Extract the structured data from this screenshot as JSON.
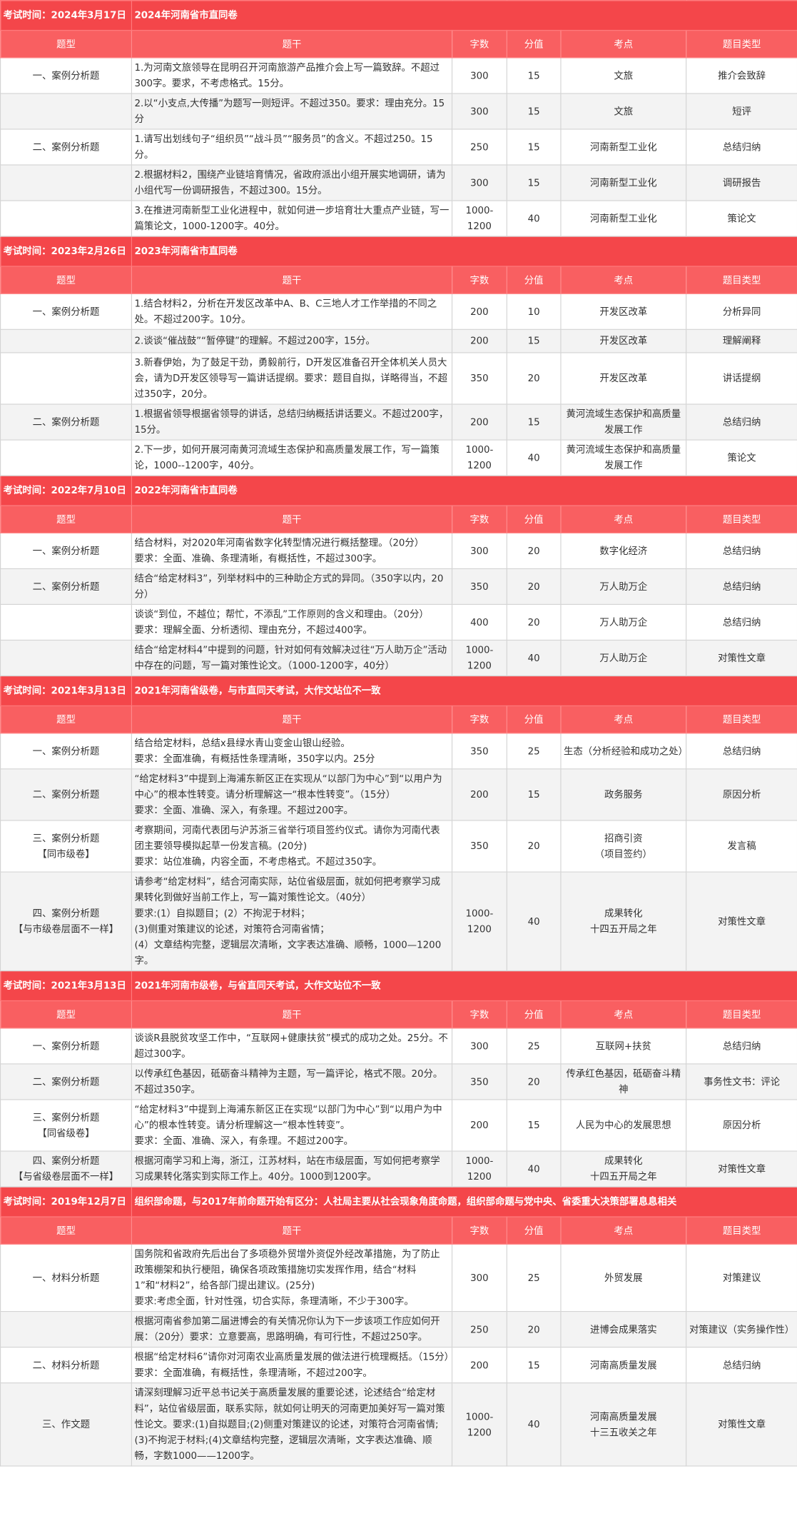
{
  "headers": [
    "题型",
    "题干",
    "字数",
    "分值",
    "考点",
    "题目类型"
  ],
  "sections": [
    {
      "time": "考试时间：2024年3月17日",
      "title": "2024年河南省市直同卷",
      "rows": [
        {
          "type": [
            "一、案例分析题"
          ],
          "stem": [
            "1.为河南文旅领导在昆明召开河南旅游产品推介会上写一篇致辞。不超过300字。要求，不考虑格式。15分。"
          ],
          "words": "300",
          "score": "15",
          "point": [
            "文旅"
          ],
          "qtype": "推介会致辞",
          "h": 39
        },
        {
          "type": [],
          "stem": [
            "2.以“小支点,大传播”为题写一则短评。不超过350。要求：理由充分。15分"
          ],
          "words": "300",
          "score": "15",
          "point": [
            "文旅"
          ],
          "qtype": "短评",
          "h": 28
        },
        {
          "type": [
            "二、案例分析题"
          ],
          "stem": [
            "1.请写出划线句子“组织员”“战斗员”“服务员”的含义。不超过250。15分。"
          ],
          "words": "250",
          "score": "15",
          "point": [
            "河南新型工业化"
          ],
          "qtype": "总结归纳",
          "h": 38
        },
        {
          "type": [],
          "stem": [
            "2.根据材料2，围绕产业链培育情况，省政府派出小组开展实地调研，请为小组代写一份调研报告，不超过300。15分。"
          ],
          "words": "300",
          "score": "15",
          "point": [
            "河南新型工业化"
          ],
          "qtype": "调研报告",
          "h": 38
        },
        {
          "type": [],
          "stem": [
            "3.在推进河南新型工业化进程中，就如何进一步培育壮大重点产业链，写一篇策论文，1000-1200字。40分。"
          ],
          "words": "1000-1200",
          "score": "40",
          "point": [
            "河南新型工业化"
          ],
          "qtype": "策论文",
          "h": 38
        }
      ]
    },
    {
      "time": "考试时间：2023年2月26日",
      "title": "2023年河南省市直同卷",
      "rows": [
        {
          "type": [
            "一、案例分析题"
          ],
          "stem": [
            "1.结合材料2，分析在开发区改革中A、B、C三地人才工作举措的不同之处。不超过200字。10分。"
          ],
          "words": "200",
          "score": "10",
          "point": [
            "开发区改革"
          ],
          "qtype": "分析异同",
          "h": 38
        },
        {
          "type": [],
          "stem": [
            "2.谈谈“催战鼓”“暂停键”的理解。不超过200字，15分。"
          ],
          "words": "200",
          "score": "15",
          "point": [
            "开发区改革"
          ],
          "qtype": "理解阐释",
          "h": 28
        },
        {
          "type": [],
          "stem": [
            "3.新春伊始，为了鼓足干劲，勇毅前行，D开发区准备召开全体机关人员大会，请为D开发区领导写一篇讲话提纲。要求：题目自拟，详略得当，不超过350字，20分。"
          ],
          "words": "350",
          "score": "20",
          "point": [
            "开发区改革"
          ],
          "qtype": "讲话提纲",
          "h": 57
        },
        {
          "type": [
            "二、案例分析题"
          ],
          "stem": [
            "1.根据省领导根据省领导的讲话，总结归纳概括讲话要义。不超过200字，15分。"
          ],
          "words": "200",
          "score": "15",
          "point": [
            "黄河流域生态保护和高质量发展工作"
          ],
          "qtype": "总结归纳",
          "h": 38
        },
        {
          "type": [],
          "stem": [
            "2.下一步，如何开展河南黄河流域生态保护和高质量发展工作，写一篇策论，1000--1200字，40分。"
          ],
          "words": "1000-1200",
          "score": "40",
          "point": [
            "黄河流域生态保护和高质量发展工作"
          ],
          "qtype": "策论文",
          "h": 38
        }
      ]
    },
    {
      "time": "考试时间：2022年7月10日",
      "title": "2022年河南省市直同卷",
      "rows": [
        {
          "type": [
            "一、案例分析题"
          ],
          "stem": [
            "结合材料，对2020年河南省数字化转型情况进行概括整理。（20分）",
            "要求：全面、准确、条理清晰，有概括性，不超过300字。"
          ],
          "words": "300",
          "score": "20",
          "point": [
            "数字化经济"
          ],
          "qtype": "总结归纳",
          "h": 38
        },
        {
          "type": [
            "二、案例分析题"
          ],
          "stem": [
            "结合“给定材料3”，列举材料中的三种助企方式的异同。（350字以内，20分）"
          ],
          "words": "350",
          "score": "20",
          "point": [
            "万人助万企"
          ],
          "qtype": "总结归纳",
          "h": 38
        },
        {
          "type": [],
          "stem": [
            "谈谈“到位，不越位；帮忙，不添乱”工作原则的含义和理由。（20分）",
            "要求：理解全面、分析透彻、理由充分，不超过400字。"
          ],
          "words": "400",
          "score": "20",
          "point": [
            "万人助万企"
          ],
          "qtype": "总结归纳",
          "h": 38
        },
        {
          "type": [],
          "stem": [
            "结合“给定材料4”中提到的问题，针对如何有效解决过往“万人助万企”活动中存在的问题，写一篇对策性论文。（1000-1200字，40分）"
          ],
          "words": "1000-1200",
          "score": "40",
          "point": [
            "万人助万企"
          ],
          "qtype": "对策性文章",
          "h": 38
        }
      ]
    },
    {
      "time": "考试时间：2021年3月13日",
      "title": "2021年河南省级卷，与市直同天考试，大作文站位不一致",
      "rows": [
        {
          "type": [
            "一、案例分析题"
          ],
          "stem": [
            "结合给定材料，总结x县绿水青山变金山银山经验。",
            "要求：全面准确，有概括性条理清晰，350字以内。25分"
          ],
          "words": "350",
          "score": "25",
          "point": [
            "生态（分析经验和成功之处）"
          ],
          "qtype": "总结归纳",
          "h": 38
        },
        {
          "type": [
            "二、案例分析题"
          ],
          "stem": [
            "“给定材料3”中提到上海浦东新区正在实现从“以部门为中心”到“以用户为中心”的根本性转变。请分析理解这一“根本性转变”。（15分）",
            "要求：全面、准确、深入，有条理。不超过200字。"
          ],
          "words": "200",
          "score": "15",
          "point": [
            "政务服务"
          ],
          "qtype": "原因分析",
          "h": 57
        },
        {
          "type": [
            "三、案例分析题",
            "【同市级卷】"
          ],
          "stem": [
            "考察期间，河南代表团与沪苏浙三省举行项目签约仪式。请你为河南代表团主要领导模拟起草一份发言稿。(20分)",
            "要求：站位准确，内容全面，不考虑格式。不超过350字。"
          ],
          "words": "350",
          "score": "20",
          "point": [
            "招商引资",
            "（项目签约）"
          ],
          "qtype": "发言稿",
          "h": 57
        },
        {
          "type": [
            "四、案例分析题",
            "【与市级卷层面不一样】"
          ],
          "stem": [
            "请参考“给定材料”，结合河南实际，站位省级层面，就如何把考察学习成果转化到做好当前工作上，写一篇对策性论文。（40分）",
            "要求:(1）自拟题目；(2）不拘泥于材料；",
            "(3)侧重对策建议的论述，对策符合河南省情；",
            "(4）文章结构完整，逻辑层次清晰，文字表达准确、顺畅，1000—1200字。"
          ],
          "words": "1000-1200",
          "score": "40",
          "point": [
            "成果转化",
            "十四五开局之年"
          ],
          "qtype": "对策性文章",
          "h": 95
        }
      ]
    },
    {
      "time": "考试时间：2021年3月13日",
      "title": "2021年河南市级卷，与省直同天考试，大作文站位不一致",
      "rows": [
        {
          "type": [
            "一、案例分析题"
          ],
          "stem": [
            "谈谈R县脱贫攻坚工作中，“互联网+健康扶贫”模式的成功之处。25分。不超过300字。"
          ],
          "words": "300",
          "score": "25",
          "point": [
            "互联网+扶贫"
          ],
          "qtype": "总结归纳",
          "h": 38
        },
        {
          "type": [
            "二、案例分析题"
          ],
          "stem": [
            "以传承红色基因，砥砺奋斗精神为主题，写一篇评论，格式不限。20分。不超过350字。"
          ],
          "words": "350",
          "score": "20",
          "point": [
            "传承红色基因，砥砺奋斗精神"
          ],
          "qtype": "事务性文书：评论",
          "h": 38
        },
        {
          "type": [
            "三、案例分析题",
            "【同省级卷】"
          ],
          "stem": [
            "“给定材料3”中提到上海浦东新区正在实现“以部门为中心”到“以用户为中心”的根本性转变。请分析理解这一“根本性转变”。",
            "要求：全面、准确、深入，有条理。不超过200字。"
          ],
          "words": "200",
          "score": "15",
          "point": [
            "人民为中心的发展思想"
          ],
          "qtype": "原因分析",
          "h": 57
        },
        {
          "type": [
            "四、案例分析题",
            "【与省级卷层面不一样】"
          ],
          "stem": [
            "根据河南学习和上海，浙江，江苏材料，站在市级层面，写如何把考察学习成果转化落实到实际工作上。40分。1000到1200字。"
          ],
          "words": "1000-1200",
          "score": "40",
          "point": [
            "成果转化",
            "十四五开局之年"
          ],
          "qtype": "对策性文章",
          "h": 38
        }
      ]
    },
    {
      "time": "考试时间：2019年12月7日",
      "title": "组织部命题，与2017年前命题开始有区分：人社局主要从社会现象角度命题，组织部命题与党中央、省委重大决策部署息息相关",
      "rows": [
        {
          "type": [
            "一、材料分析题"
          ],
          "stem": [
            "国务院和省政府先后出台了多项稳外贸增外资促外经改革措施，为了防止政策棚架和执行梗阻，确保各项政策措施切实发挥作用，结合“材料1”和“材料2”，给各部门提出建议。(25分)",
            "要求:考虑全面，针对性强，切合实际，条理清晰，不少于300字。"
          ],
          "words": "300",
          "score": "25",
          "point": [
            "外贸发展"
          ],
          "qtype": "对策建议",
          "h": 76
        },
        {
          "type": [],
          "stem": [
            "根据河南省参加第二届进博会的有关情况你认为下一步该项工作应如何开展：（20分）要求：立意要高，思路明确，有可行性，不超过250字。"
          ],
          "words": "250",
          "score": "20",
          "point": [
            "进博会成果落实"
          ],
          "qtype": "对策建议（实务操作性）",
          "h": 38
        },
        {
          "type": [
            "二、材料分析题"
          ],
          "stem": [
            "根据“给定材料6”请你对河南农业高质量发展的做法进行梳理概括。（15分）要求：全面准确，有概括性，条理清晰，不超过200字。"
          ],
          "words": "200",
          "score": "15",
          "point": [
            "河南高质量发展"
          ],
          "qtype": "总结归纳",
          "h": 38
        },
        {
          "type": [
            "三、作文题"
          ],
          "stem": [
            "请深刻理解习近平总书记关于高质量发展的重要论述，论述结合“给定材料”，站位省级层面，联系实际，就如何让明天的河南更加美好写一篇对策性论文。要求:(1)自拟题目;(2)侧重对策建议的论述，对策符合河南省情;(3)不拘泥于材料;(4)文章结构完整，逻辑层次清晰，文字表达准确、顺畅，字数1000——1200字。"
          ],
          "words": "1000-1200",
          "score": "40",
          "point": [
            "河南高质量发展",
            "十三五收关之年"
          ],
          "qtype": "对策性文章",
          "h": 95
        }
      ]
    }
  ]
}
